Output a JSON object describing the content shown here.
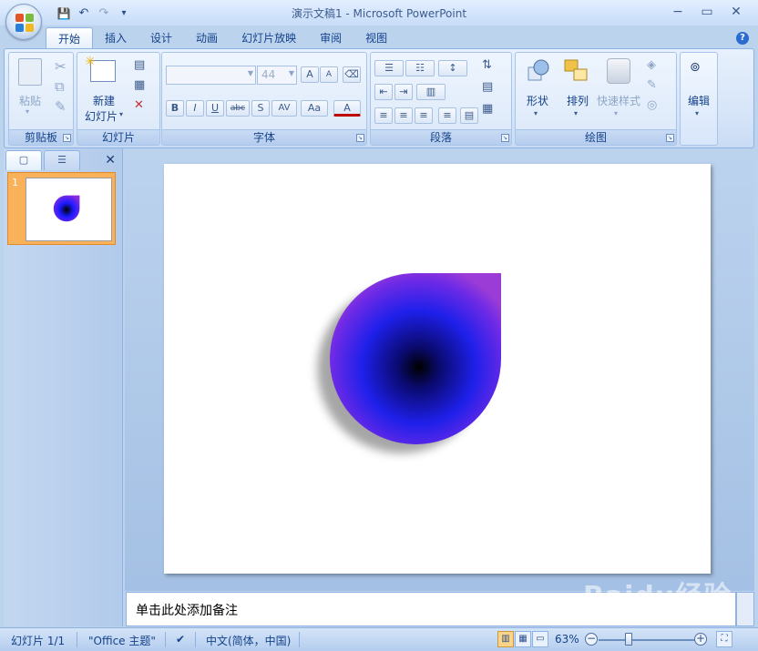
{
  "window": {
    "title": "演示文稿1 - Microsoft PowerPoint",
    "controls": {
      "minimize": "−",
      "restore": "▭",
      "close": "✕"
    }
  },
  "quick_access": {
    "save": "💾",
    "undo": "↶",
    "redo": "↷",
    "customize": "▾"
  },
  "tabs": [
    {
      "label": "开始",
      "active": true
    },
    {
      "label": "插入"
    },
    {
      "label": "设计"
    },
    {
      "label": "动画"
    },
    {
      "label": "幻灯片放映"
    },
    {
      "label": "审阅"
    },
    {
      "label": "视图"
    }
  ],
  "ribbon": {
    "clipboard": {
      "label": "剪贴板",
      "paste": "粘贴"
    },
    "slides": {
      "label": "幻灯片",
      "new_slide_line1": "新建",
      "new_slide_line2": "幻灯片"
    },
    "font": {
      "label": "字体",
      "font_name": "",
      "font_size": "44",
      "bold": "B",
      "italic": "I",
      "underline": "U",
      "strike": "abc",
      "shadow": "S",
      "spacing": "AV",
      "case": "Aa",
      "color": "A",
      "grow": "A",
      "shrink": "A"
    },
    "paragraph": {
      "label": "段落"
    },
    "drawing": {
      "label": "绘图",
      "shapes": "形状",
      "arrange": "排列",
      "quick_styles": "快速样式"
    },
    "editing": {
      "label": "编辑"
    }
  },
  "left_pane": {
    "slide_number": "1",
    "close": "✕"
  },
  "notes": {
    "placeholder": "单击此处添加备注"
  },
  "watermark": "Baidu经验",
  "status": {
    "slide": "幻灯片 1/1",
    "theme": "\"Office 主题\"",
    "language": "中文(简体，中国)",
    "zoom": "63%",
    "zoom_minus": "−",
    "zoom_plus": "+"
  },
  "colors": {
    "drop_outer": "#8a2be2",
    "drop_mid": "#1a1aff",
    "drop_center": "#000000",
    "thumb_selected": "#f9b25a"
  }
}
